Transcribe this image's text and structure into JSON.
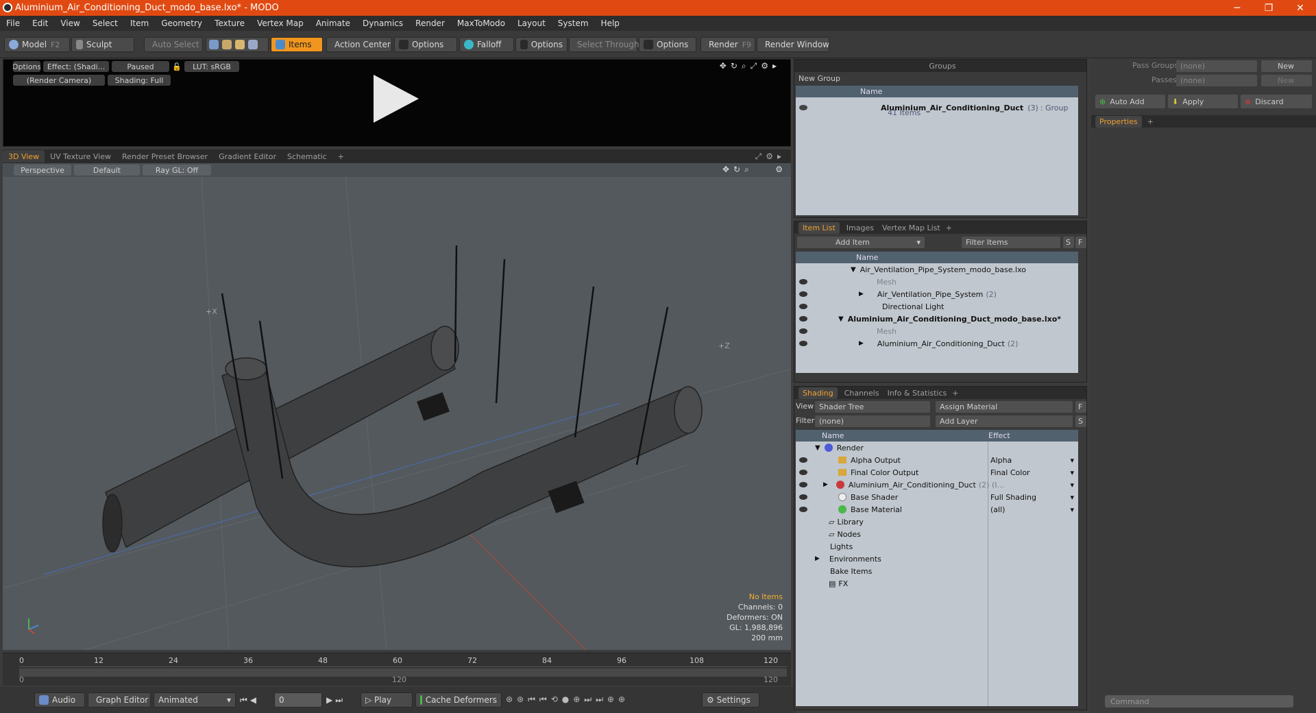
{
  "window": {
    "title": "Aluminium_Air_Conditioning_Duct_modo_base.lxo* - MODO"
  },
  "menu": [
    "File",
    "Edit",
    "View",
    "Select",
    "Item",
    "Geometry",
    "Texture",
    "Vertex Map",
    "Animate",
    "Dynamics",
    "Render",
    "MaxToModo",
    "Layout",
    "System",
    "Help"
  ],
  "toolbar": {
    "model": "Model",
    "model_key": "F2",
    "sculpt": "Sculpt",
    "auto_select": "Auto Select",
    "items": "Items",
    "action_center": "Action Center",
    "options1": "Options",
    "falloff": "Falloff",
    "options2": "Options",
    "select_through": "Select Through",
    "options3": "Options",
    "render": "Render",
    "render_key": "F9",
    "render_window": "Render Window"
  },
  "preview": {
    "options": "Options",
    "effect": "Effect: (Shadi...",
    "paused": "Paused",
    "lut": "LUT: sRGB",
    "camera": "(Render Camera)",
    "shading": "Shading: Full"
  },
  "viewport_tabs": [
    "3D View",
    "UV Texture View",
    "Render Preset Browser",
    "Gradient Editor",
    "Schematic",
    "+"
  ],
  "viewport": {
    "perspective": "Perspective",
    "default": "Default",
    "raygl": "Ray GL: Off",
    "hud": {
      "no_items": "No Items",
      "channels": "Channels: 0",
      "deformers": "Deformers: ON",
      "gl": "GL: 1,988,896",
      "scale": "200 mm"
    }
  },
  "timeline": {
    "ticks": [
      "0",
      "12",
      "24",
      "36",
      "48",
      "60",
      "72",
      "84",
      "96",
      "108",
      "120"
    ],
    "start": "0",
    "end": "120",
    "mid": "120"
  },
  "bottom": {
    "audio": "Audio",
    "graph_editor": "Graph Editor",
    "animated": "Animated",
    "frame": "0",
    "play": "Play",
    "cache": "Cache Deformers",
    "settings": "Settings"
  },
  "groups": {
    "title": "Groups",
    "new_group": "New Group",
    "col_name": "Name",
    "item_name": "Aluminium_Air_Conditioning_Duct",
    "item_count": "(3)",
    "item_type": ": Group",
    "item_sub": "41 Items"
  },
  "item_list": {
    "tabs": [
      "Item List",
      "Images",
      "Vertex Map List",
      "+"
    ],
    "add_item": "Add Item",
    "filter": "Filter Items",
    "s": "S",
    "f": "F",
    "col_name": "Name",
    "rows": [
      {
        "label": "Air_Ventilation_Pipe_System_modo_base.lxo",
        "indent": 0,
        "bold": false,
        "dim": false
      },
      {
        "label": "Mesh",
        "indent": 2,
        "bold": false,
        "dim": true
      },
      {
        "label": "Air_Ventilation_Pipe_System",
        "count": "(2)",
        "indent": 2,
        "bold": false,
        "dim": false
      },
      {
        "label": "Directional Light",
        "indent": 2,
        "bold": false,
        "dim": false
      },
      {
        "label": "Aluminium_Air_Conditioning_Duct_modo_base.lxo*",
        "indent": 0,
        "bold": true,
        "dim": false
      },
      {
        "label": "Mesh",
        "indent": 2,
        "bold": false,
        "dim": true
      },
      {
        "label": "Aluminium_Air_Conditioning_Duct",
        "count": "(2)",
        "indent": 2,
        "bold": false,
        "dim": false
      }
    ]
  },
  "shading": {
    "tabs": [
      "Shading",
      "Channels",
      "Info & Statistics",
      "+"
    ],
    "view_label": "View",
    "view_value": "Shader Tree",
    "assign": "Assign Material",
    "f": "F",
    "filter_label": "Filter",
    "filter_value": "(none)",
    "add_layer": "Add Layer",
    "s": "S",
    "col_name": "Name",
    "col_effect": "Effect",
    "rows": [
      {
        "label": "Render",
        "effect": ""
      },
      {
        "label": "Alpha Output",
        "effect": "Alpha"
      },
      {
        "label": "Final Color Output",
        "effect": "Final Color"
      },
      {
        "label": "Aluminium_Air_Conditioning_Duct",
        "count": "(2) (I...",
        "effect": ""
      },
      {
        "label": "Base Shader",
        "effect": "Full Shading"
      },
      {
        "label": "Base Material",
        "effect": "(all)"
      },
      {
        "label": "Library",
        "effect": ""
      },
      {
        "label": "Nodes",
        "effect": ""
      },
      {
        "label": "Lights",
        "effect": ""
      },
      {
        "label": "Environments",
        "effect": ""
      },
      {
        "label": "Bake Items",
        "effect": ""
      },
      {
        "label": "FX",
        "effect": ""
      }
    ]
  },
  "properties": {
    "pass_groups": "Pass Groups",
    "passes": "Passes",
    "none": "(none)",
    "new": "New",
    "auto_add": "Auto Add",
    "apply": "Apply",
    "discard": "Discard",
    "tab": "Properties",
    "plus": "+",
    "command": "Command"
  },
  "colors": {
    "accent": "#f0a030",
    "title_bar": "#e04a12"
  }
}
